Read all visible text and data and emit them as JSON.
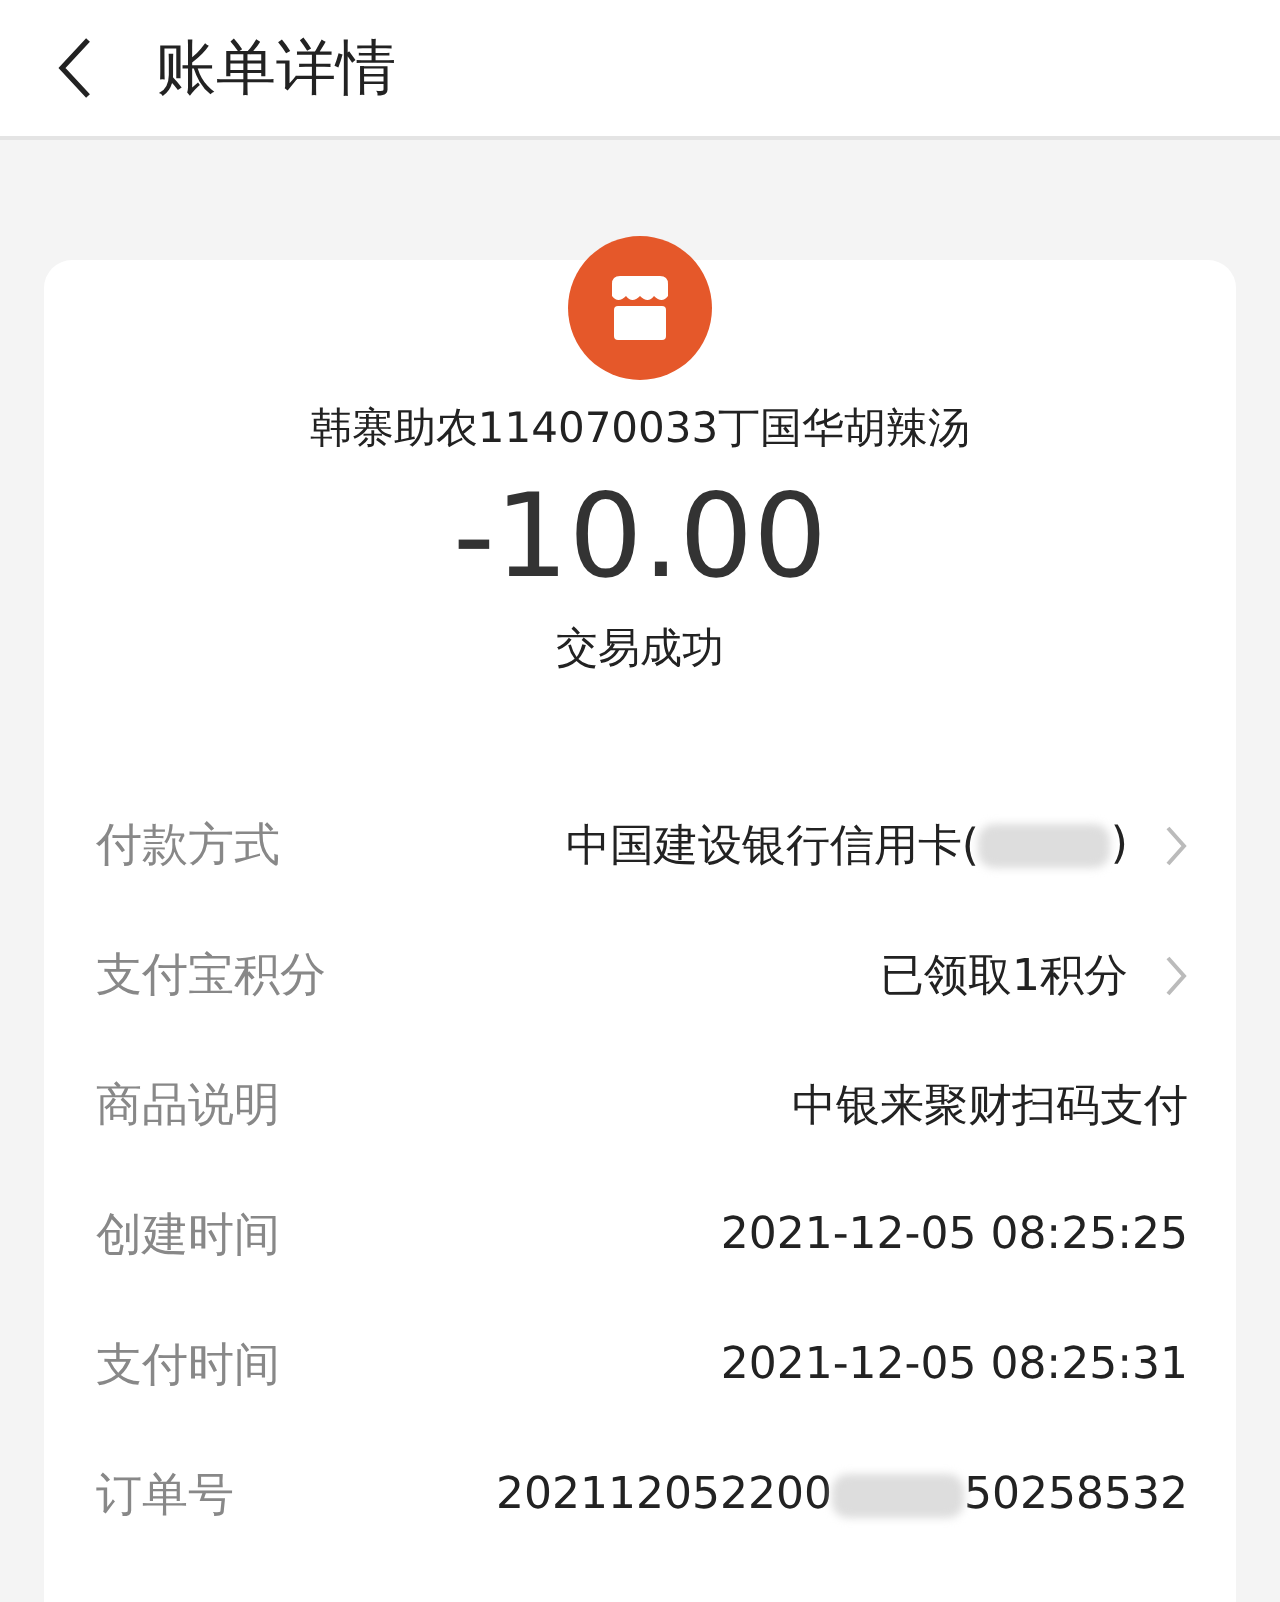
{
  "header": {
    "title": "账单详情"
  },
  "merchant": "韩寨助农114070033丁国华胡辣汤",
  "amount": "-10.00",
  "status": "交易成功",
  "rows": [
    {
      "label": "付款方式",
      "value": "中国建设银行信用卡(",
      "redacted": true,
      "value_after": ")",
      "link": true
    },
    {
      "label": "支付宝积分",
      "value": "已领取1积分",
      "redacted": false,
      "link": true
    },
    {
      "label": "商品说明",
      "value": "中银来聚财扫码支付",
      "redacted": false,
      "link": false
    },
    {
      "label": "创建时间",
      "value": "2021-12-05 08:25:25",
      "redacted": false,
      "link": false
    },
    {
      "label": "支付时间",
      "value": "2021-12-05 08:25:31",
      "redacted": false,
      "link": false
    },
    {
      "label": "订单号",
      "value": "202112052200",
      "redacted": true,
      "value_after": "50258532",
      "link": false
    }
  ]
}
